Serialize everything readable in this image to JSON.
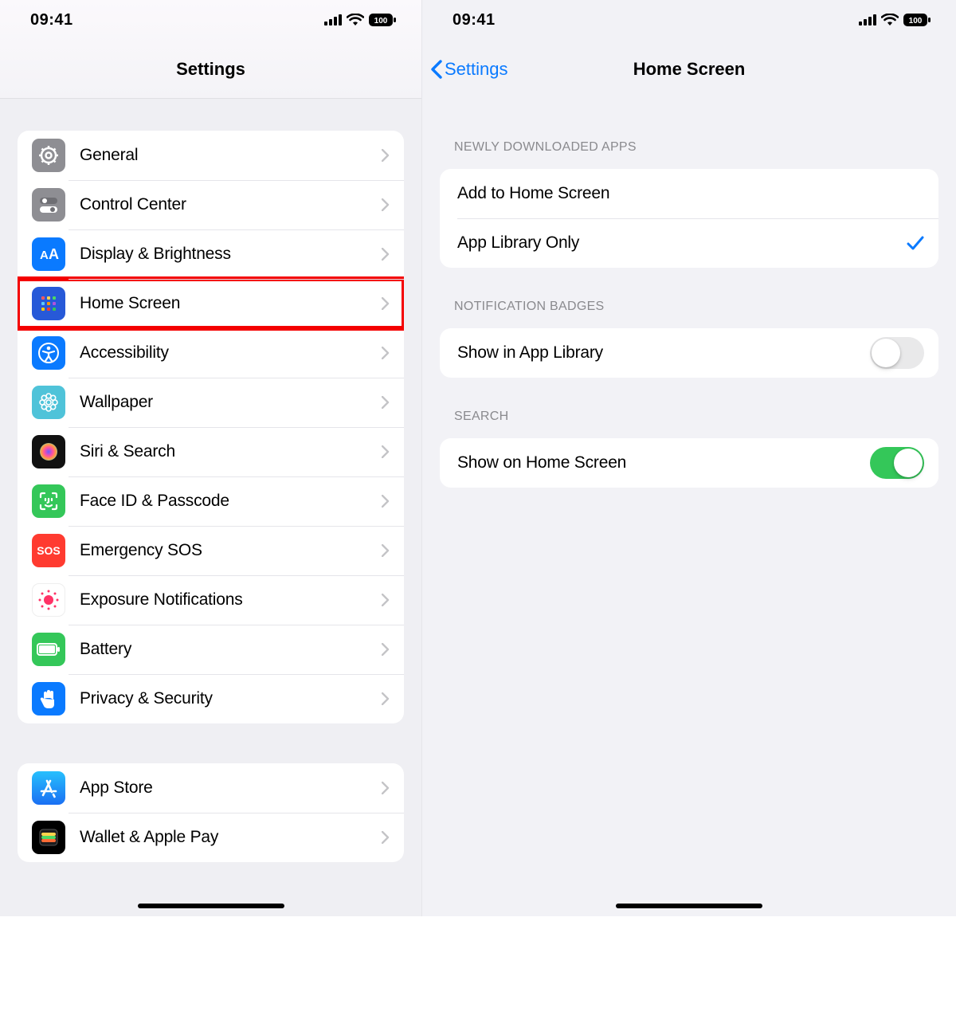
{
  "status": {
    "time": "09:41",
    "battery": "100"
  },
  "left": {
    "title": "Settings",
    "groups": [
      {
        "rows": [
          {
            "label": "General",
            "icon": "gear-icon",
            "bg": "bg-gray"
          },
          {
            "label": "Control Center",
            "icon": "switches-icon",
            "bg": "bg-gray"
          },
          {
            "label": "Display & Brightness",
            "icon": "aa-icon",
            "bg": "bg-blue"
          },
          {
            "label": "Home Screen",
            "icon": "grid-icon",
            "bg": "bg-homegrid",
            "highlight": true
          },
          {
            "label": "Accessibility",
            "icon": "accessibility-icon",
            "bg": "bg-blue"
          },
          {
            "label": "Wallpaper",
            "icon": "flower-icon",
            "bg": "bg-cyan"
          },
          {
            "label": "Siri & Search",
            "icon": "siri-icon",
            "bg": "bg-abyss"
          },
          {
            "label": "Face ID & Passcode",
            "icon": "faceid-icon",
            "bg": "bg-green"
          },
          {
            "label": "Emergency SOS",
            "icon": "sos-icon",
            "bg": "bg-red"
          },
          {
            "label": "Exposure Notifications",
            "icon": "exposure-icon",
            "bg": "bg-white"
          },
          {
            "label": "Battery",
            "icon": "battery-icon",
            "bg": "bg-green"
          },
          {
            "label": "Privacy & Security",
            "icon": "hand-icon",
            "bg": "bg-blue"
          }
        ]
      },
      {
        "rows": [
          {
            "label": "App Store",
            "icon": "appstore-icon",
            "bg": "bg-blue"
          },
          {
            "label": "Wallet & Apple Pay",
            "icon": "wallet-icon",
            "bg": "bg-black"
          }
        ]
      }
    ]
  },
  "right": {
    "back": "Settings",
    "title": "Home Screen",
    "sections": [
      {
        "header": "NEWLY DOWNLOADED APPS",
        "rows": [
          {
            "label": "Add to Home Screen",
            "checked": false
          },
          {
            "label": "App Library Only",
            "checked": true
          }
        ]
      },
      {
        "header": "NOTIFICATION BADGES",
        "rows": [
          {
            "label": "Show in App Library",
            "toggle": false
          }
        ]
      },
      {
        "header": "SEARCH",
        "rows": [
          {
            "label": "Show on Home Screen",
            "toggle": true
          }
        ]
      }
    ]
  }
}
